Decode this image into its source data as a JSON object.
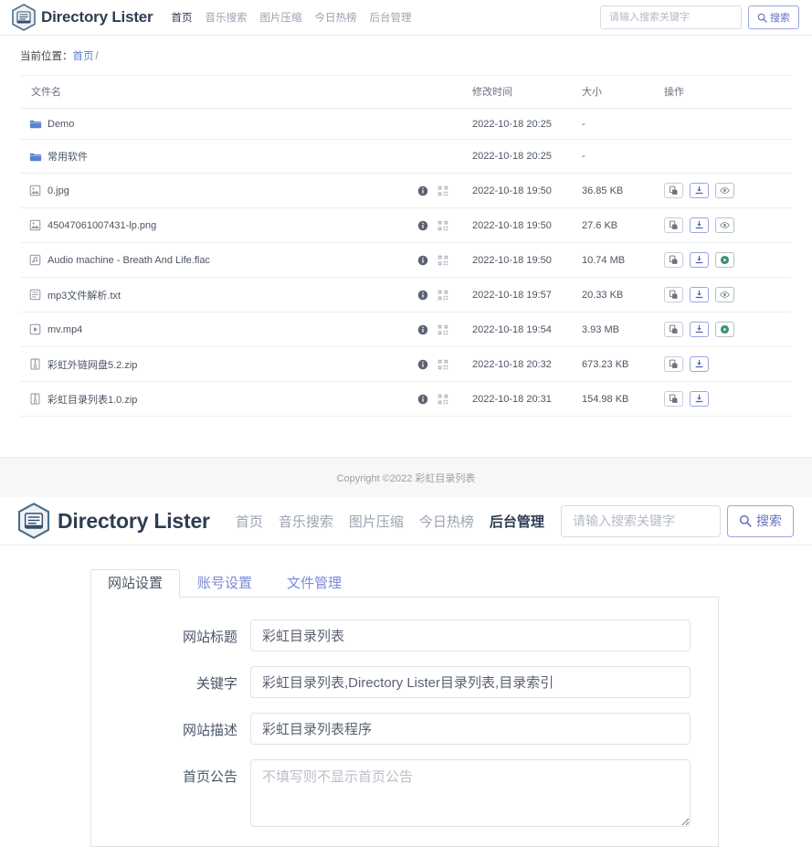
{
  "header": {
    "brand": "Directory Lister",
    "logo_icon": "hexagon-book-icon",
    "nav": [
      {
        "label": "首页",
        "active": true
      },
      {
        "label": "音乐搜索",
        "active": false
      },
      {
        "label": "图片压缩",
        "active": false
      },
      {
        "label": "今日热榜",
        "active": false
      },
      {
        "label": "后台管理",
        "active": false
      }
    ],
    "search_placeholder": "请输入搜索关键字",
    "search_value": "",
    "search_button": "搜索",
    "search_icon": "magnifier-icon"
  },
  "header2": {
    "brand": "Directory Lister",
    "logo_icon": "hexagon-book-icon",
    "nav": [
      {
        "label": "首页",
        "active": false
      },
      {
        "label": "音乐搜索",
        "active": false
      },
      {
        "label": "图片压缩",
        "active": false
      },
      {
        "label": "今日热榜",
        "active": false
      },
      {
        "label": "后台管理",
        "active": true
      }
    ],
    "search_placeholder": "请输入搜索关键字",
    "search_value": "",
    "search_button": "搜索",
    "search_icon": "magnifier-icon"
  },
  "breadcrumb": {
    "prefix": "当前位置：",
    "home": "首页",
    "separator": "/"
  },
  "table": {
    "headers": {
      "name": "文件名",
      "mtime": "修改时间",
      "size": "大小",
      "ops": "操作"
    },
    "rows": [
      {
        "name": "Demo",
        "icon": "folder-icon",
        "type": "folder",
        "mtime": "2022-10-18 20:25",
        "size": "-",
        "mid_icons": [],
        "ops": []
      },
      {
        "name": "常用软件",
        "icon": "folder-icon",
        "type": "folder",
        "mtime": "2022-10-18 20:25",
        "size": "-",
        "mid_icons": [],
        "ops": []
      },
      {
        "name": "0.jpg",
        "icon": "image-file-icon",
        "type": "image",
        "mtime": "2022-10-18 19:50",
        "size": "36.85 KB",
        "mid_icons": [
          "info-icon",
          "qrcode-icon"
        ],
        "ops": [
          "copy-icon",
          "download-icon",
          "eye-icon"
        ]
      },
      {
        "name": "45047061007431-lp.png",
        "icon": "image-file-icon",
        "type": "image",
        "mtime": "2022-10-18 19:50",
        "size": "27.6 KB",
        "mid_icons": [
          "info-icon",
          "qrcode-icon"
        ],
        "ops": [
          "copy-icon",
          "download-icon",
          "eye-icon"
        ]
      },
      {
        "name": "Audio machine - Breath And Life.flac",
        "icon": "audio-file-icon",
        "type": "audio",
        "mtime": "2022-10-18 19:50",
        "size": "10.74 MB",
        "mid_icons": [
          "info-icon",
          "qrcode-icon"
        ],
        "ops": [
          "copy-icon",
          "download-icon",
          "play-icon"
        ]
      },
      {
        "name": "mp3文件解析.txt",
        "icon": "text-file-icon",
        "type": "text",
        "mtime": "2022-10-18 19:57",
        "size": "20.33 KB",
        "mid_icons": [
          "info-icon",
          "qrcode-icon"
        ],
        "ops": [
          "copy-icon",
          "download-icon",
          "eye-icon"
        ]
      },
      {
        "name": "mv.mp4",
        "icon": "video-file-icon",
        "type": "video",
        "mtime": "2022-10-18 19:54",
        "size": "3.93 MB",
        "mid_icons": [
          "info-icon",
          "qrcode-icon"
        ],
        "ops": [
          "copy-icon",
          "download-icon",
          "play-icon"
        ]
      },
      {
        "name": "彩虹外链网盘5.2.zip",
        "icon": "archive-file-icon",
        "type": "archive",
        "mtime": "2022-10-18 20:32",
        "size": "673.23 KB",
        "mid_icons": [
          "info-icon",
          "qrcode-icon"
        ],
        "ops": [
          "copy-icon",
          "download-icon"
        ]
      },
      {
        "name": "彩虹目录列表1.0.zip",
        "icon": "archive-file-icon",
        "type": "archive",
        "mtime": "2022-10-18 20:31",
        "size": "154.98 KB",
        "mid_icons": [
          "info-icon",
          "qrcode-icon"
        ],
        "ops": [
          "copy-icon",
          "download-icon"
        ]
      }
    ]
  },
  "footer": {
    "copyright": "Copyright ©2022 彩虹目录列表"
  },
  "admin": {
    "tabs": [
      {
        "label": "网站设置",
        "active": true
      },
      {
        "label": "账号设置",
        "active": false
      },
      {
        "label": "文件管理",
        "active": false
      }
    ],
    "fields": [
      {
        "label": "网站标题",
        "value": "彩虹目录列表",
        "placeholder": "",
        "multiline": false
      },
      {
        "label": "关键字",
        "value": "彩虹目录列表,Directory Lister目录列表,目录索引",
        "placeholder": "",
        "multiline": false
      },
      {
        "label": "网站描述",
        "value": "彩虹目录列表程序",
        "placeholder": "",
        "multiline": false
      },
      {
        "label": "首页公告",
        "value": "",
        "placeholder": "不填写则不显示首页公告",
        "multiline": true
      }
    ]
  },
  "colors": {
    "brand_dark": "#2f3d52",
    "accent_blue": "#5b7fd4",
    "link_purple": "#6272c4",
    "muted": "#9aa3b0",
    "folder_blue": "#5b7fd4",
    "play_teal": "#3f8f7a"
  }
}
